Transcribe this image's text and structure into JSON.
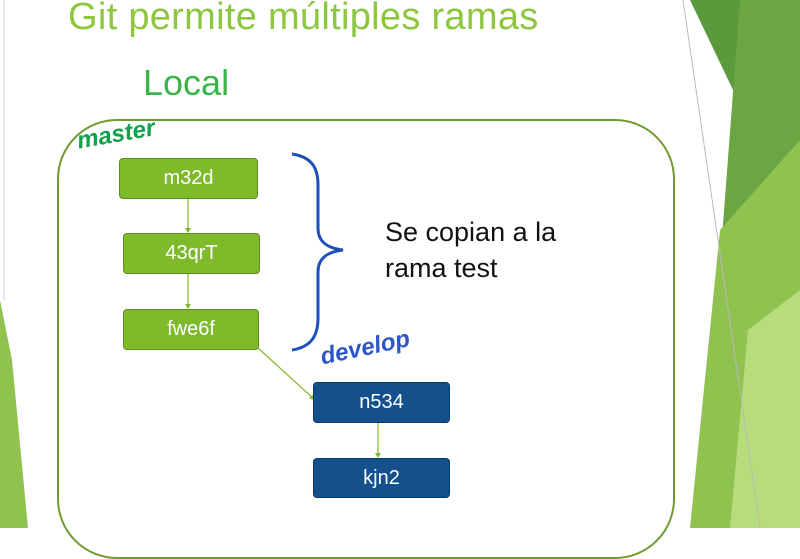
{
  "slide": {
    "title": "Git permite múltiples ramas",
    "subtitle": "Local"
  },
  "branches": {
    "master": "master",
    "develop": "develop"
  },
  "commits": {
    "c1": "m32d",
    "c2": "43qrT",
    "c3": "fwe6f",
    "c4": "n534",
    "c5": "kjn2"
  },
  "annotation": "Se copian a la rama test",
  "colors": {
    "accent_green": "#8dc63f",
    "commit_green": "#7fba2a",
    "commit_blue": "#14508b",
    "brace_blue": "#1f4fb8"
  }
}
